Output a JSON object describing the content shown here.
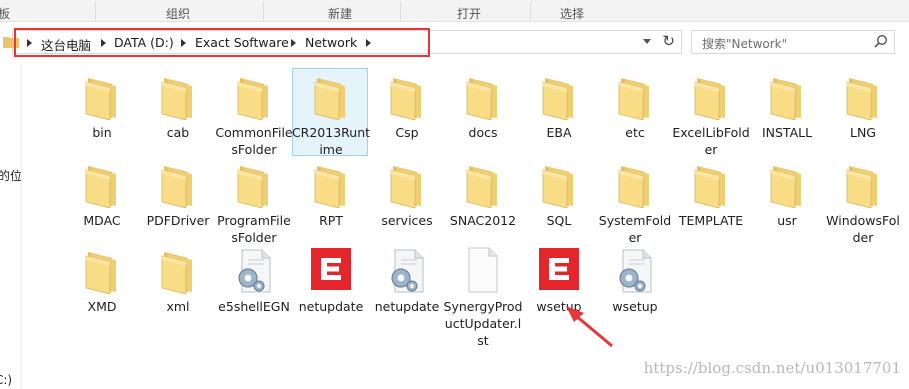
{
  "ribbon": {
    "items": [
      "板",
      "组织",
      "新建",
      "打开",
      "选择"
    ]
  },
  "address": {
    "crumbs": [
      "这台电脑",
      "DATA (D:)",
      "Exact Software",
      "Network"
    ]
  },
  "search": {
    "placeholder": "搜索\"Network\""
  },
  "nav": {
    "item1": "的位置",
    "item2": "C:)"
  },
  "files": [
    {
      "name": "bin",
      "type": "folder"
    },
    {
      "name": "cab",
      "type": "folder"
    },
    {
      "name": "CommonFilesFolder",
      "type": "folder"
    },
    {
      "name": "CR2013Runtime",
      "type": "folder",
      "selected": true
    },
    {
      "name": "Csp",
      "type": "folder"
    },
    {
      "name": "docs",
      "type": "folder"
    },
    {
      "name": "EBA",
      "type": "folder"
    },
    {
      "name": "etc",
      "type": "folder"
    },
    {
      "name": "ExcelLibFolder",
      "type": "folder"
    },
    {
      "name": "INSTALL",
      "type": "folder"
    },
    {
      "name": "LNG",
      "type": "folder"
    },
    {
      "name": "MDAC",
      "type": "folder"
    },
    {
      "name": "PDFDriver",
      "type": "folder"
    },
    {
      "name": "ProgramFilesFolder",
      "type": "folder"
    },
    {
      "name": "RPT",
      "type": "folder"
    },
    {
      "name": "services",
      "type": "folder"
    },
    {
      "name": "SNAC2012",
      "type": "folder"
    },
    {
      "name": "SQL",
      "type": "folder"
    },
    {
      "name": "SystemFolder",
      "type": "folder"
    },
    {
      "name": "TEMPLATE",
      "type": "folder"
    },
    {
      "name": "usr",
      "type": "folder"
    },
    {
      "name": "WindowsFolder",
      "type": "folder"
    },
    {
      "name": "XMD",
      "type": "folder"
    },
    {
      "name": "xml",
      "type": "folder"
    },
    {
      "name": "e5shellEGN",
      "type": "config"
    },
    {
      "name": "netupdate",
      "type": "exact-app"
    },
    {
      "name": "netupdate",
      "type": "config"
    },
    {
      "name": "SynergyProductUpdater.lst",
      "type": "document"
    },
    {
      "name": "wsetup",
      "type": "exact-app"
    },
    {
      "name": "wsetup",
      "type": "config"
    }
  ],
  "watermark": "https://blog.csdn.net/u013017701",
  "colors": {
    "highlight": "#e8353a",
    "exact_red": "#e3262b",
    "folder": "#f3d27a"
  }
}
